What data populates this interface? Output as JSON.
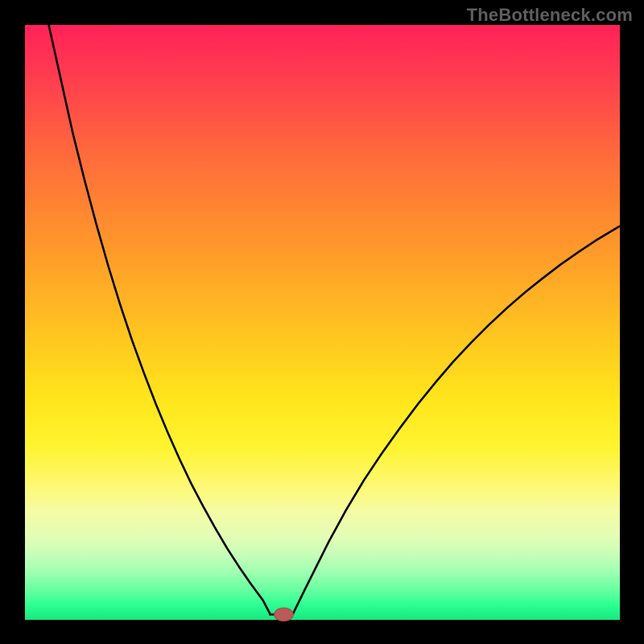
{
  "watermark": "TheBottleneck.com",
  "colors": {
    "frame": "#000000",
    "gradient_top": "#ff2158",
    "gradient_mid": "#ffe61c",
    "gradient_bottom": "#18e77f",
    "curve": "#000000",
    "marker_fill": "#bb5a57",
    "marker_stroke": "#985149"
  },
  "chart_data": {
    "type": "line",
    "title": "",
    "xlabel": "",
    "ylabel": "",
    "xlim": [
      0,
      100
    ],
    "ylim": [
      0,
      100
    ],
    "marker": {
      "x": 43.5,
      "y": 0.9,
      "rx": 1.6,
      "ry": 1.1
    },
    "series": [
      {
        "name": "left-branch",
        "x": [
          4.0,
          6,
          8,
          10,
          12,
          14,
          16,
          18,
          20,
          22,
          24,
          26,
          28,
          30,
          32,
          34,
          36,
          38,
          40,
          41.2
        ],
        "y": [
          100,
          91,
          82,
          74,
          66.5,
          59.5,
          53,
          47,
          41.5,
          36.3,
          31.5,
          27.0,
          22.8,
          19.0,
          15.4,
          12.0,
          8.9,
          6.0,
          3.3,
          1.0
        ]
      },
      {
        "name": "flat",
        "x": [
          41.2,
          45.0
        ],
        "y": [
          0.9,
          0.9
        ]
      },
      {
        "name": "right-branch",
        "x": [
          45.0,
          47,
          49,
          51,
          54,
          57,
          60,
          63,
          66,
          69,
          72,
          75,
          78,
          81,
          84,
          87,
          90,
          93,
          96,
          99,
          100
        ],
        "y": [
          0.9,
          5,
          9,
          13,
          18.5,
          23.5,
          28,
          32.2,
          36.2,
          39.9,
          43.4,
          46.6,
          49.6,
          52.4,
          55.0,
          57.4,
          59.7,
          61.8,
          63.8,
          65.6,
          66.2
        ]
      }
    ]
  }
}
